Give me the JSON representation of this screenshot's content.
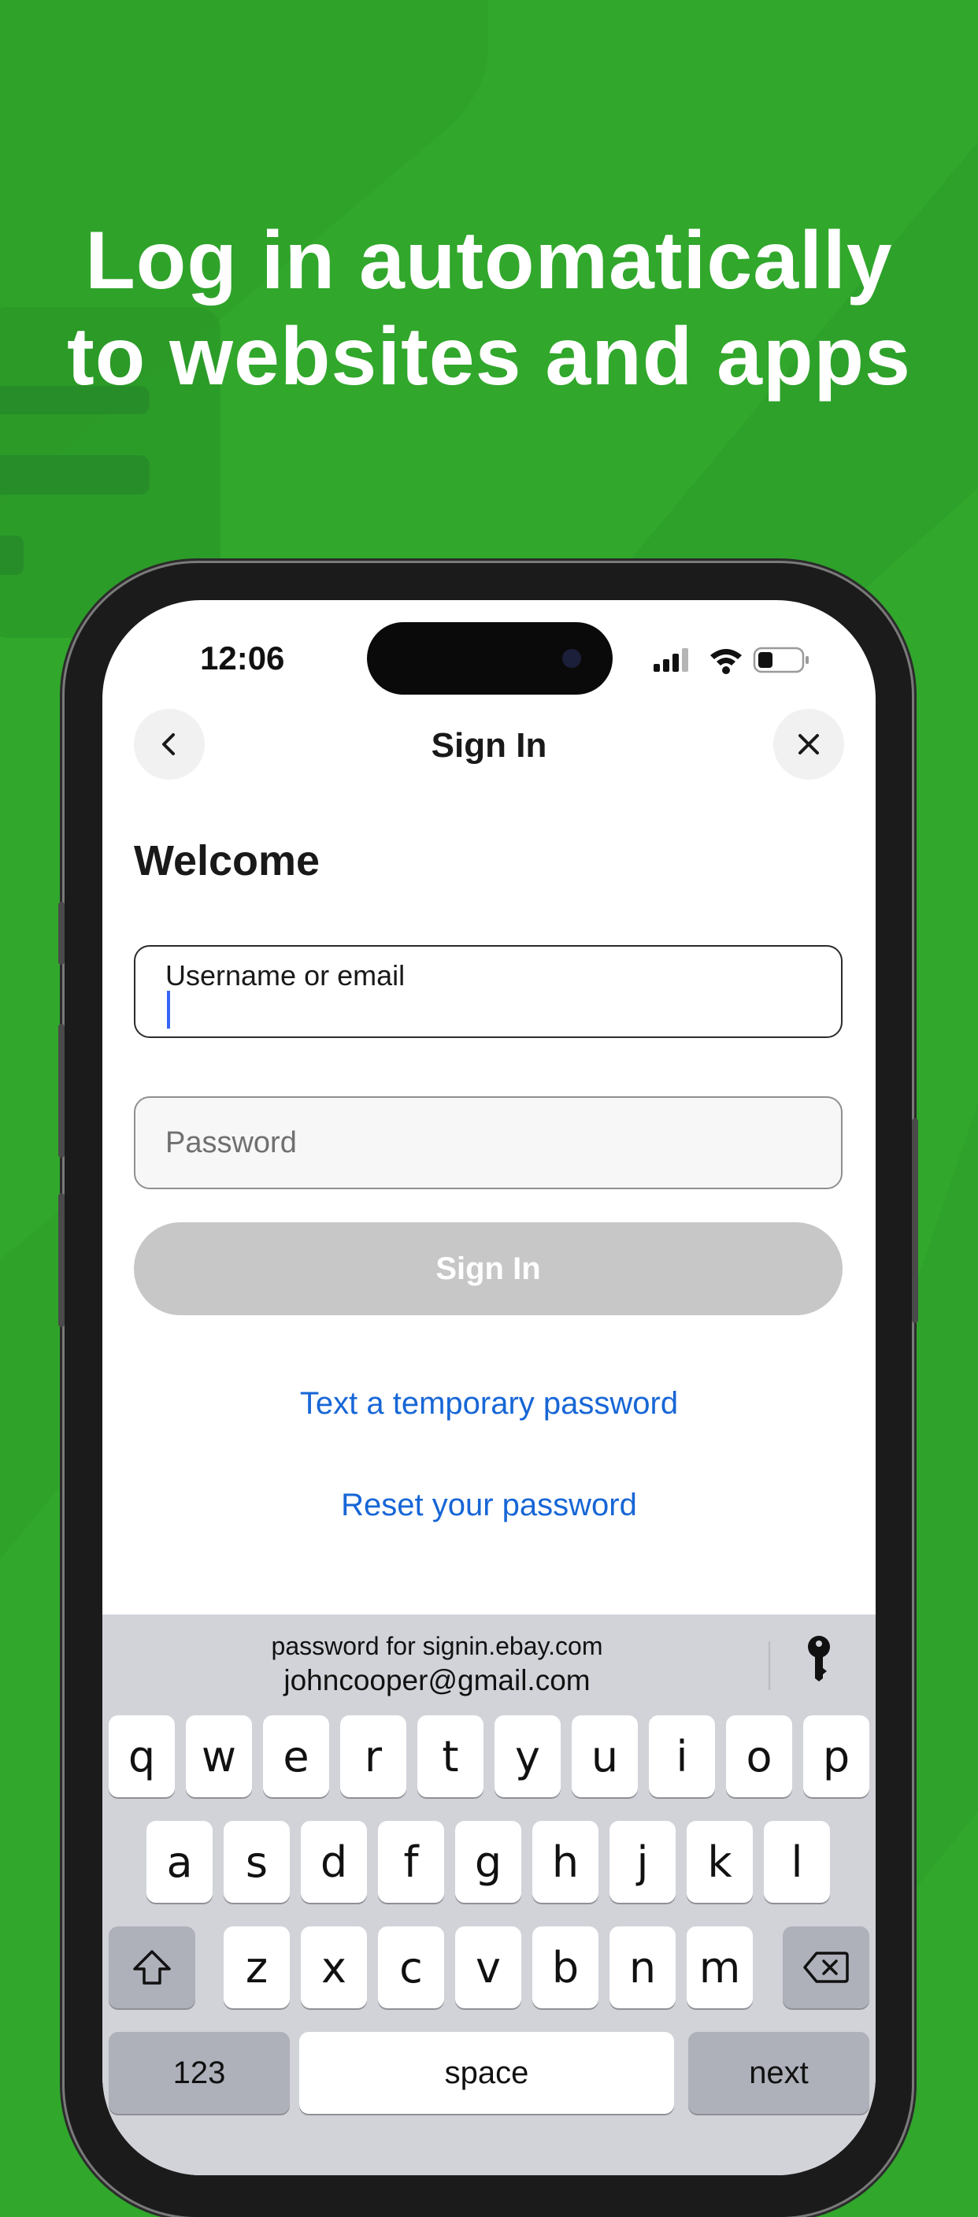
{
  "headline": {
    "line1": "Log in automatically",
    "line2": "to websites and apps"
  },
  "colors": {
    "background": "#31a72c",
    "link": "#1766d6",
    "caret": "#3665f3",
    "button_disabled": "#c7c7c7"
  },
  "status_bar": {
    "time": "12:06",
    "icons": [
      "signal-icon",
      "wifi-icon",
      "battery-icon"
    ]
  },
  "nav": {
    "back_icon": "chevron-left-icon",
    "title": "Sign In",
    "close_icon": "close-icon"
  },
  "form": {
    "welcome": "Welcome",
    "username_label": "Username or email",
    "username_value": "",
    "password_placeholder": "Password",
    "signin_button": "Sign In",
    "text_temp_password_link": "Text a temporary password",
    "reset_password_link": "Reset your password"
  },
  "keyboard": {
    "suggestion_sub": "password for signin.ebay.com",
    "suggestion_main": "johncooper@gmail.com",
    "key_icon": "key-icon",
    "row1": [
      "q",
      "w",
      "e",
      "r",
      "t",
      "y",
      "u",
      "i",
      "o",
      "p"
    ],
    "row2": [
      "a",
      "s",
      "d",
      "f",
      "g",
      "h",
      "j",
      "k",
      "l"
    ],
    "row3": [
      "z",
      "x",
      "c",
      "v",
      "b",
      "n",
      "m"
    ],
    "shift_icon": "shift-icon",
    "delete_icon": "delete-icon",
    "numbers_key": "123",
    "space_key": "space",
    "next_key": "next"
  }
}
